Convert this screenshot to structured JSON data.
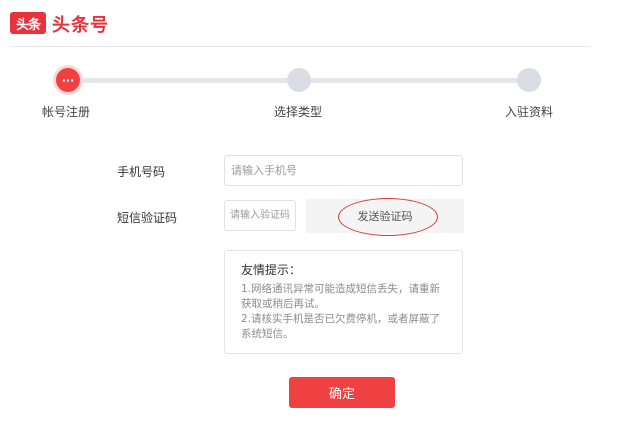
{
  "header": {
    "logo_mark": "头条",
    "logo_text": "头条号"
  },
  "steps": {
    "active_glyph": "···",
    "items": [
      {
        "label": "帐号注册"
      },
      {
        "label": "选择类型"
      },
      {
        "label": "入驻资料"
      }
    ]
  },
  "form": {
    "phone_label": "手机号码",
    "phone_placeholder": "请输入手机号",
    "code_label": "短信验证码",
    "code_placeholder": "请输入验证码",
    "send_code_label": "发送验证码"
  },
  "tips": {
    "title": "友情提示：",
    "lines": [
      "1.网络通讯异常可能造成短信丢失，请重新",
      "获取或稍后再试。",
      "2.请核实手机是否已欠费停机，或者屏蔽了",
      "系统短信。"
    ]
  },
  "actions": {
    "confirm_label": "确定"
  },
  "colors": {
    "brand": "#e8323c",
    "primary_button": "#f04142"
  }
}
